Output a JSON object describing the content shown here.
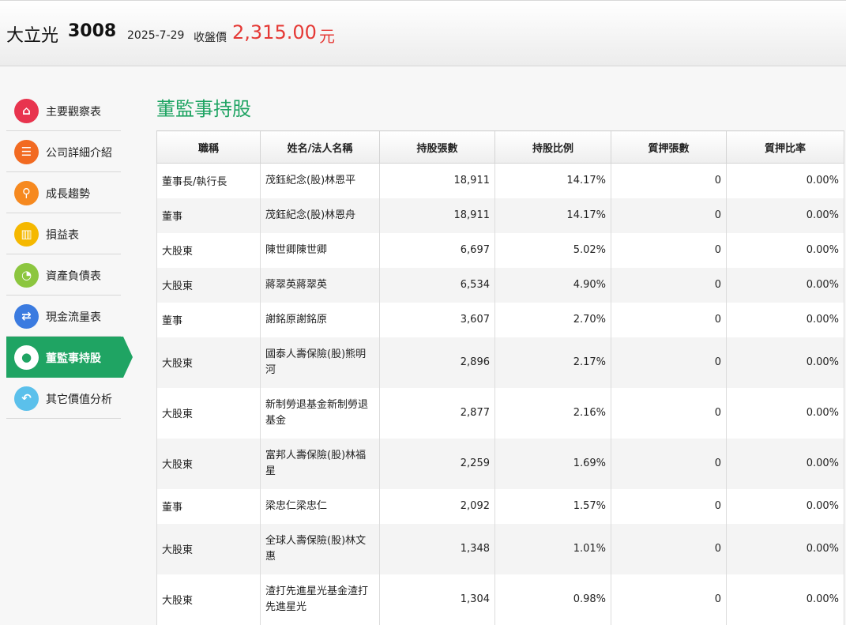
{
  "header": {
    "company_name": "大立光",
    "stock_code": "3008",
    "date": "2025-7-29",
    "price_label": "收盤價",
    "price": "2,315.00",
    "price_unit": "元"
  },
  "sidebar": {
    "items": [
      {
        "label": "主要觀察表",
        "icon": "home-icon",
        "color": "#e8344e",
        "glyph": "⌂"
      },
      {
        "label": "公司詳細介紹",
        "icon": "list-icon",
        "color": "#f26a21",
        "glyph": "☰"
      },
      {
        "label": "成長趨勢",
        "icon": "search-icon",
        "color": "#f6891f",
        "glyph": "⚲"
      },
      {
        "label": "損益表",
        "icon": "bar-chart-icon",
        "color": "#f5b800",
        "glyph": "▥"
      },
      {
        "label": "資產負債表",
        "icon": "pie-chart-icon",
        "color": "#8cc63f",
        "glyph": "◔"
      },
      {
        "label": "現金流量表",
        "icon": "exchange-icon",
        "color": "#3b7be0",
        "glyph": "⇄"
      },
      {
        "label": "董監事持股",
        "icon": "user-icon",
        "color": "#1fa463",
        "glyph": "●",
        "active": true
      },
      {
        "label": "其它價值分析",
        "icon": "reply-icon",
        "color": "#5bc0eb",
        "glyph": "↶"
      }
    ]
  },
  "main": {
    "title": "董監事持股",
    "table": {
      "columns": [
        "職稱",
        "姓名/法人名稱",
        "持股張數",
        "持股比例",
        "質押張數",
        "質押比率"
      ],
      "rows": [
        [
          "董事長/執行長",
          "茂鈺紀念(股)林恩平",
          "18,911",
          "14.17%",
          "0",
          "0.00%"
        ],
        [
          "董事",
          "茂鈺紀念(股)林恩舟",
          "18,911",
          "14.17%",
          "0",
          "0.00%"
        ],
        [
          "大股東",
          "陳世卿陳世卿",
          "6,697",
          "5.02%",
          "0",
          "0.00%"
        ],
        [
          "大股東",
          "蔣翠英蔣翠英",
          "6,534",
          "4.90%",
          "0",
          "0.00%"
        ],
        [
          "董事",
          "謝銘原謝銘原",
          "3,607",
          "2.70%",
          "0",
          "0.00%"
        ],
        [
          "大股東",
          "國泰人壽保險(股)熊明河",
          "2,896",
          "2.17%",
          "0",
          "0.00%"
        ],
        [
          "大股東",
          "新制勞退基金新制勞退基金",
          "2,877",
          "2.16%",
          "0",
          "0.00%"
        ],
        [
          "大股東",
          "富邦人壽保險(股)林福星",
          "2,259",
          "1.69%",
          "0",
          "0.00%"
        ],
        [
          "董事",
          "梁忠仁梁忠仁",
          "2,092",
          "1.57%",
          "0",
          "0.00%"
        ],
        [
          "大股東",
          "全球人壽保險(股)林文惠",
          "1,348",
          "1.01%",
          "0",
          "0.00%"
        ],
        [
          "大股東",
          "渣打先進星光基金渣打先進星光",
          "1,304",
          "0.98%",
          "0",
          "0.00%"
        ]
      ]
    }
  }
}
